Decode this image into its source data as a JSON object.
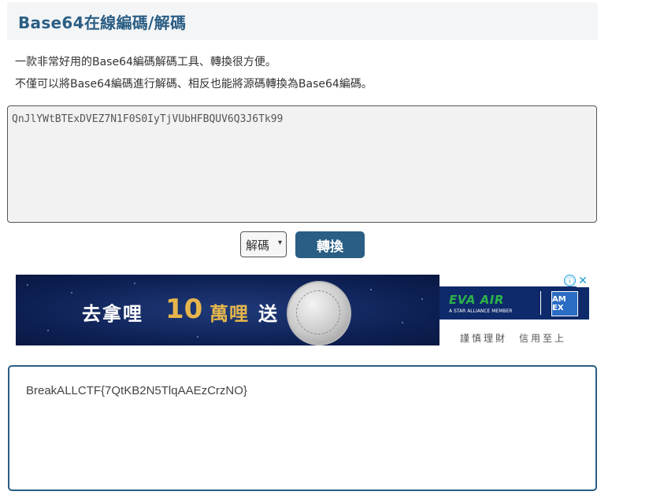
{
  "header": {
    "title": "Base64在線編碼/解碼"
  },
  "description": {
    "line1": "一款非常好用的Base64編碼解碼工具、轉換很方便。",
    "line2": "不僅可以將Base64編碼進行解碼、相反也能將源碼轉換為Base64編碼。"
  },
  "input": {
    "value": "QnJlYWtBTExDVEZ7N1F0S0IyTjVUbHFBQUV6Q3J6Tk99"
  },
  "controls": {
    "mode_selected": "解碼",
    "mode_arrow": "▾",
    "convert_label": "轉換"
  },
  "ad": {
    "headline_1": "去拿哩",
    "headline_num": "10",
    "headline_2": "萬哩",
    "headline_3": "送",
    "brand": "EVA AIR",
    "brand_sub": "A STAR ALLIANCE MEMBER",
    "partner": "AM EX",
    "tagline": "謹慎理財　信用至上",
    "info_icon": "ⓘ",
    "close_icon": "✕",
    "colors": {
      "banner_bg": "#0d1f52",
      "gold": "#e6b64c",
      "eva_green": "#2db34a"
    }
  },
  "output": {
    "value": "BreakALLCTF{7QtKB2N5TlqAAEzCrzNO}"
  },
  "colors": {
    "accent": "#2a5e84",
    "input_bg": "#f2f2f2"
  }
}
